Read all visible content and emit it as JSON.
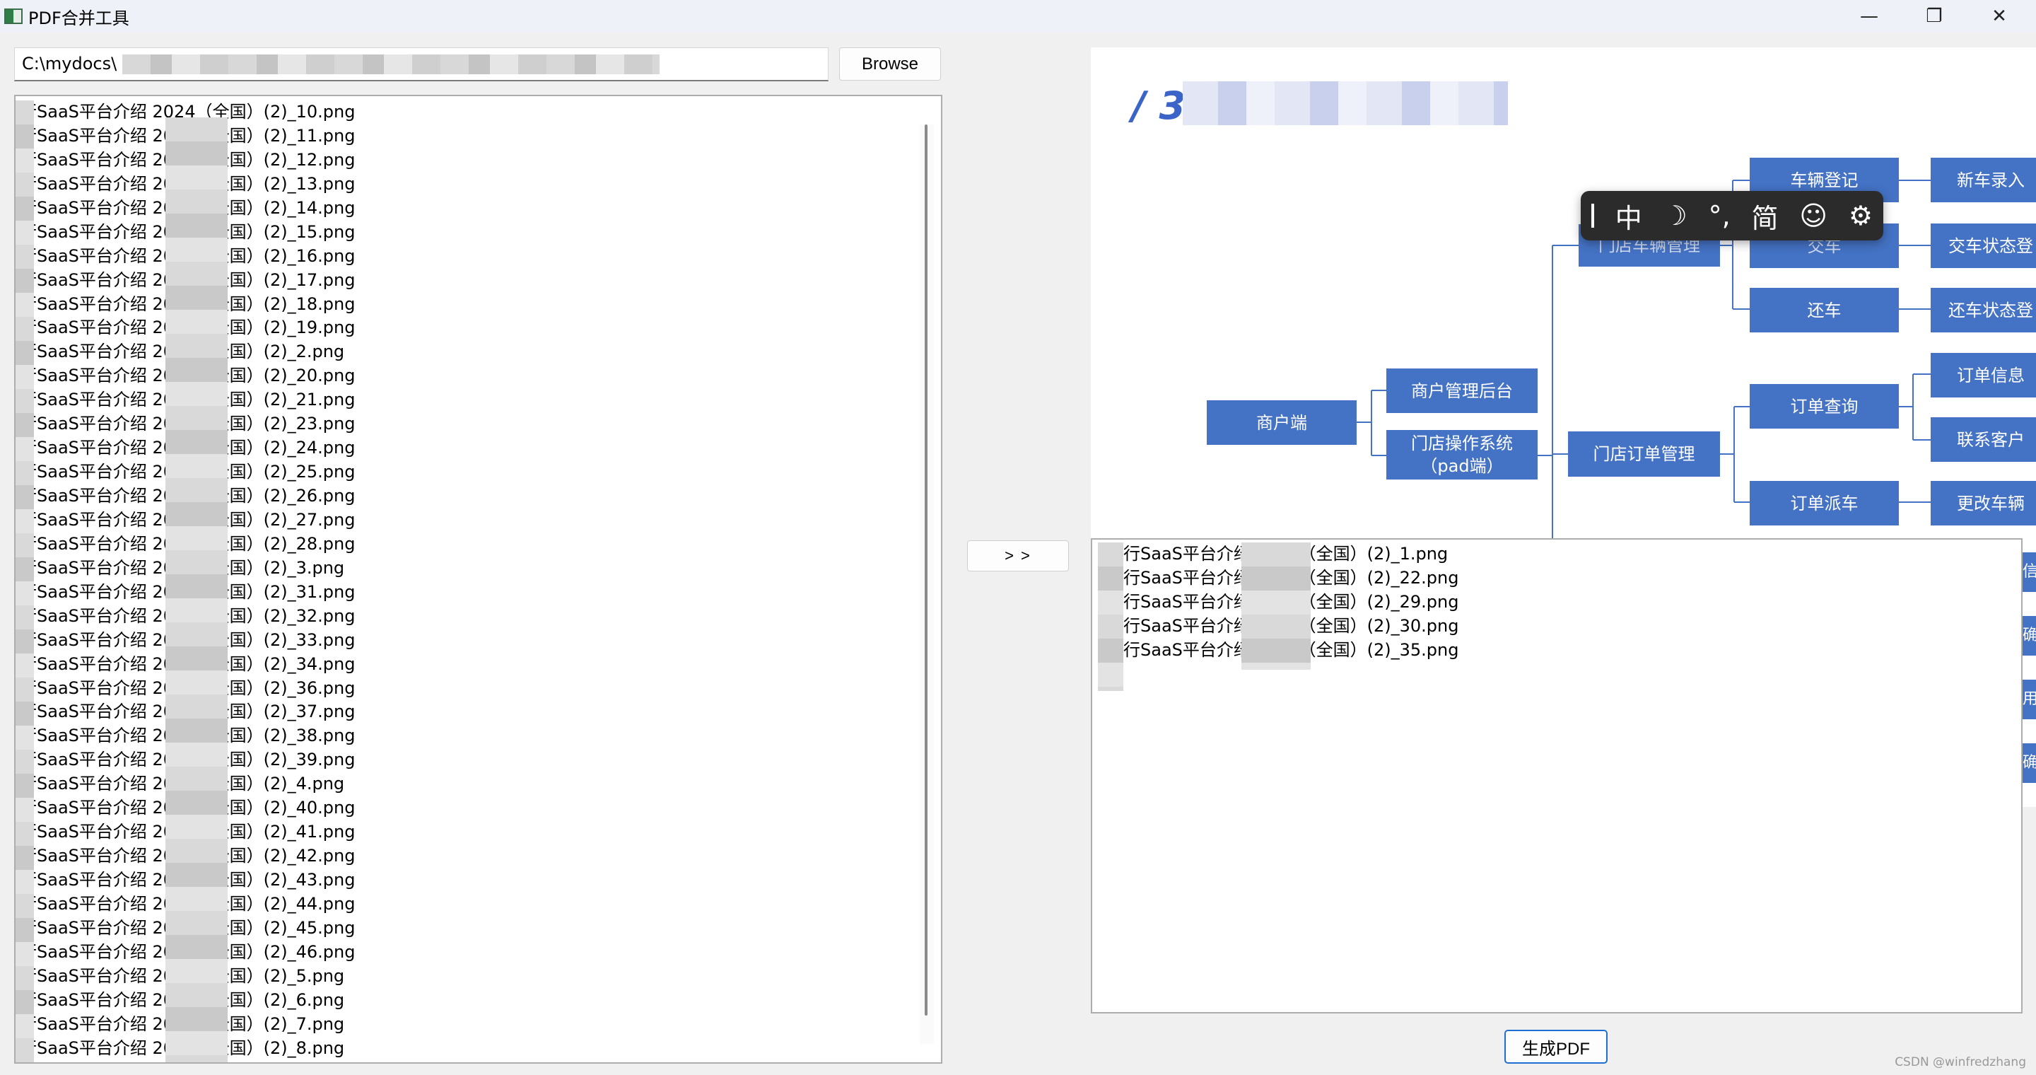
{
  "window": {
    "title": "PDF合并工具"
  },
  "path": {
    "value": "C:\\mydocs\\"
  },
  "buttons": {
    "browse": "Browse",
    "move": "> >",
    "generate": "生成PDF"
  },
  "left_list": [
    "行SaaS平台介绍 2024（全国）(2)_10.png",
    "行SaaS平台介绍 2024（全国）(2)_11.png",
    "行SaaS平台介绍 2024（全国）(2)_12.png",
    "行SaaS平台介绍 2024（全国）(2)_13.png",
    "行SaaS平台介绍 2024（全国）(2)_14.png",
    "行SaaS平台介绍 2024（全国）(2)_15.png",
    "行SaaS平台介绍 2024（全国）(2)_16.png",
    "行SaaS平台介绍 2024（全国）(2)_17.png",
    "行SaaS平台介绍 2024（全国）(2)_18.png",
    "行SaaS平台介绍 2024（全国）(2)_19.png",
    "行SaaS平台介绍 2024（全国）(2)_2.png",
    "行SaaS平台介绍 2024（全国）(2)_20.png",
    "行SaaS平台介绍 2024（全国）(2)_21.png",
    "行SaaS平台介绍 2024（全国）(2)_23.png",
    "行SaaS平台介绍 2024（全国）(2)_24.png",
    "行SaaS平台介绍 2024（全国）(2)_25.png",
    "行SaaS平台介绍 2024（全国）(2)_26.png",
    "行SaaS平台介绍 2024（全国）(2)_27.png",
    "行SaaS平台介绍 2024（全国）(2)_28.png",
    "行SaaS平台介绍 2024（全国）(2)_3.png",
    "行SaaS平台介绍 2024（全国）(2)_31.png",
    "行SaaS平台介绍 2024（全国）(2)_32.png",
    "行SaaS平台介绍 2024（全国）(2)_33.png",
    "行SaaS平台介绍 2024（全国）(2)_34.png",
    "行SaaS平台介绍 2024（全国）(2)_36.png",
    "行SaaS平台介绍 2024（全国）(2)_37.png",
    "行SaaS平台介绍 2024（全国）(2)_38.png",
    "行SaaS平台介绍 2024（全国）(2)_39.png",
    "行SaaS平台介绍 2024（全国）(2)_4.png",
    "行SaaS平台介绍 2024（全国）(2)_40.png",
    "行SaaS平台介绍 2024（全国）(2)_41.png",
    "行SaaS平台介绍 2024（全国）(2)_42.png",
    "行SaaS平台介绍 2024（全国）(2)_43.png",
    "行SaaS平台介绍 2024（全国）(2)_44.png",
    "行SaaS平台介绍 2024（全国）(2)_45.png",
    "行SaaS平台介绍 2024（全国）(2)_46.png",
    "行SaaS平台介绍 2024（全国）(2)_5.png",
    "行SaaS平台介绍 2024（全国）(2)_6.png",
    "行SaaS平台介绍 2024（全国）(2)_7.png",
    "行SaaS平台介绍 2024（全国）(2)_8.png"
  ],
  "right_list": [
    "行SaaS平台介绍 2024（全国）(2)_1.png",
    "行SaaS平台介绍 2024（全国）(2)_22.png",
    "行SaaS平台介绍 2024（全国）(2)_29.png",
    "行SaaS平台介绍 2024（全国）(2)_30.png",
    "行SaaS平台介绍 2024（全国）(2)_35.png"
  ],
  "preview": {
    "title": "/ 3 场景",
    "nodes": {
      "merchant": "商户端",
      "merchant_admin": "商户管理后台",
      "store_os_line1": "门店操作系统",
      "store_os_line2": "（pad端）",
      "vehicle_mgmt": "门店车辆管理",
      "order_mgmt": "门店订单管理",
      "vehicle_register": "车辆登记",
      "hand_over": "交车",
      "return_car": "还车",
      "order_query": "订单查询",
      "order_dispatch": "订单派车",
      "new_car_entry": "新车录入",
      "handover_status": "交车状态登",
      "return_status": "还车状态登",
      "order_info": "订单信息",
      "contact_customer": "联系客户",
      "change_vehicle": "更改车辆",
      "edge_1": "信",
      "edge_2": "确",
      "edge_3": "用",
      "edge_4": "确"
    }
  },
  "ime_toolbar": {
    "mode": "中",
    "moon": "☽",
    "punct": "°,",
    "script": "简",
    "emoji": "☺",
    "settings": "⚙"
  },
  "watermark": "CSDN @winfredzhang",
  "colors": {
    "accent": "#4472c4",
    "primary_border": "#1f6fd2"
  }
}
